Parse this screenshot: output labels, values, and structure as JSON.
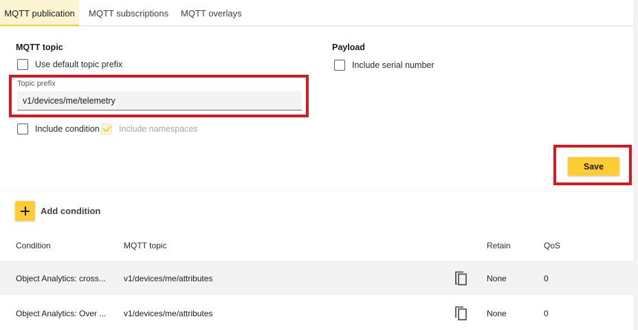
{
  "tabs": [
    {
      "label": "MQTT publication"
    },
    {
      "label": "MQTT subscriptions"
    },
    {
      "label": "MQTT overlays"
    }
  ],
  "mqtt_topic": {
    "title": "MQTT topic",
    "use_default_prefix_label": "Use default topic prefix",
    "topic_prefix_label": "Topic prefix",
    "topic_prefix_value": "v1/devices/me/telemetry",
    "include_condition_label": "Include condition",
    "include_namespaces_label": "Include namespaces"
  },
  "payload": {
    "title": "Payload",
    "include_serial_label": "Include serial number"
  },
  "save_label": "Save",
  "add_condition_label": "Add condition",
  "table": {
    "headers": [
      "Condition",
      "MQTT topic",
      "Retain",
      "QoS"
    ],
    "rows": [
      {
        "condition": "Object Analytics: cross...",
        "topic": "v1/devices/me/attributes",
        "retain": "None",
        "qos": "0"
      },
      {
        "condition": "Object Analytics: Over ...",
        "topic": "v1/devices/me/attributes",
        "retain": "None",
        "qos": "0"
      }
    ]
  },
  "colors": {
    "accent": "#ffcc33",
    "highlight": "#e2131a",
    "active_tab_bg": "#fff4d2"
  }
}
